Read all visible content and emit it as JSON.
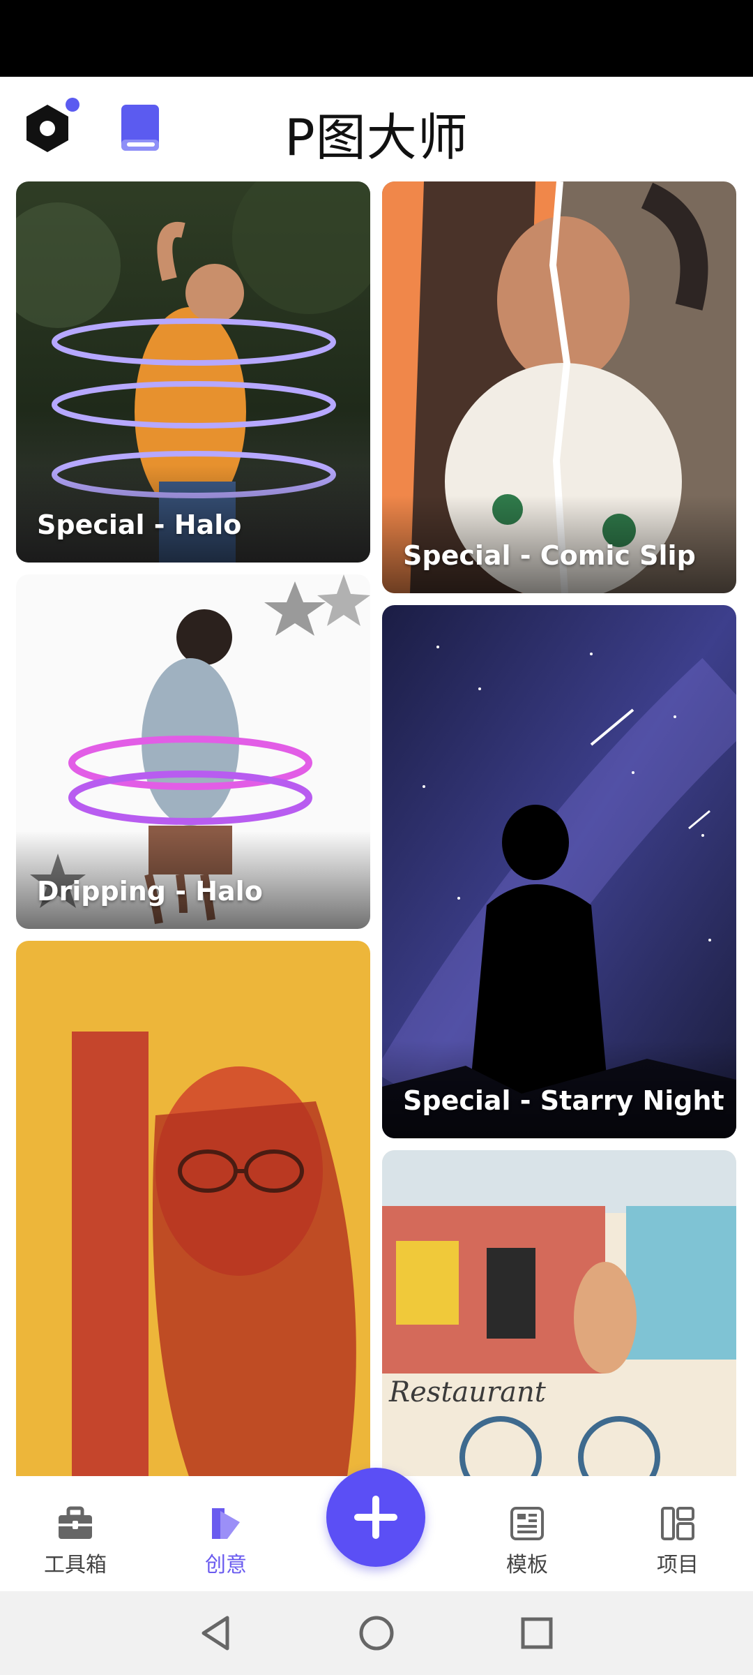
{
  "header": {
    "title": "P图大师",
    "logo_icon": "hexagon-logo-icon",
    "guide_icon": "book-icon",
    "accent": "#5b5bf0"
  },
  "feed": {
    "cards": [
      {
        "label": "Special - Halo"
      },
      {
        "label": "Special - Comic Slip"
      },
      {
        "label": "Dripping - Halo"
      },
      {
        "label": "Special - Starry Night"
      },
      {
        "label": ""
      },
      {
        "label": ""
      }
    ]
  },
  "bottom_nav": {
    "items": [
      {
        "label": "工具箱",
        "icon": "toolbox-icon"
      },
      {
        "label": "创意",
        "icon": "creative-icon",
        "active": true
      },
      {
        "label": "模板",
        "icon": "template-icon"
      },
      {
        "label": "项目",
        "icon": "project-icon"
      }
    ],
    "fab_icon": "plus-icon",
    "active_color": "#6a5bef"
  },
  "system_nav": {
    "back_icon": "back-triangle-icon",
    "home_icon": "home-circle-icon",
    "recents_icon": "recents-square-icon"
  }
}
